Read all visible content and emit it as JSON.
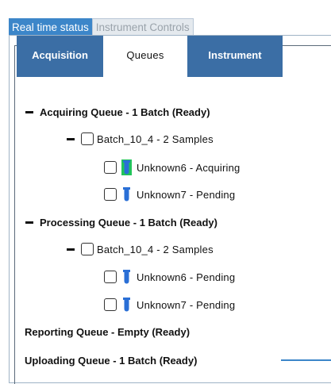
{
  "outer_tabs": [
    {
      "label": "Real time status",
      "active": true
    },
    {
      "label": "Instrument Controls",
      "active": false
    }
  ],
  "sub_tabs": [
    {
      "label": "Acquisition",
      "active": false
    },
    {
      "label": "Queues",
      "active": true
    },
    {
      "label": "Instrument",
      "active": false
    }
  ],
  "queues": {
    "acquiring": {
      "label": "Acquiring Queue - 1 Batch (Ready)",
      "batch": "Batch_10_4 - 2 Samples",
      "samples": [
        {
          "label": "Unknown6 - Acquiring",
          "icon": "vial-acquiring-icon"
        },
        {
          "label": "Unknown7 - Pending",
          "icon": "vial-pending-icon"
        }
      ]
    },
    "processing": {
      "label": "Processing Queue - 1 Batch (Ready)",
      "batch": "Batch_10_4 - 2 Samples",
      "samples": [
        {
          "label": "Unknown6 - Pending",
          "icon": "vial-pending-icon"
        },
        {
          "label": "Unknown7 - Pending",
          "icon": "vial-pending-icon"
        }
      ]
    },
    "reporting": {
      "label": "Reporting Queue - Empty (Ready)"
    },
    "uploading": {
      "label": "Uploading Queue - 1 Batch (Ready)"
    }
  },
  "colors": {
    "active_tab": "#3c86c9",
    "subtab_dark": "#3b6ea5",
    "vial_blue": "#2a6fd6",
    "vial_highlight": "#21c45a",
    "callout_line": "#3c86c9"
  }
}
